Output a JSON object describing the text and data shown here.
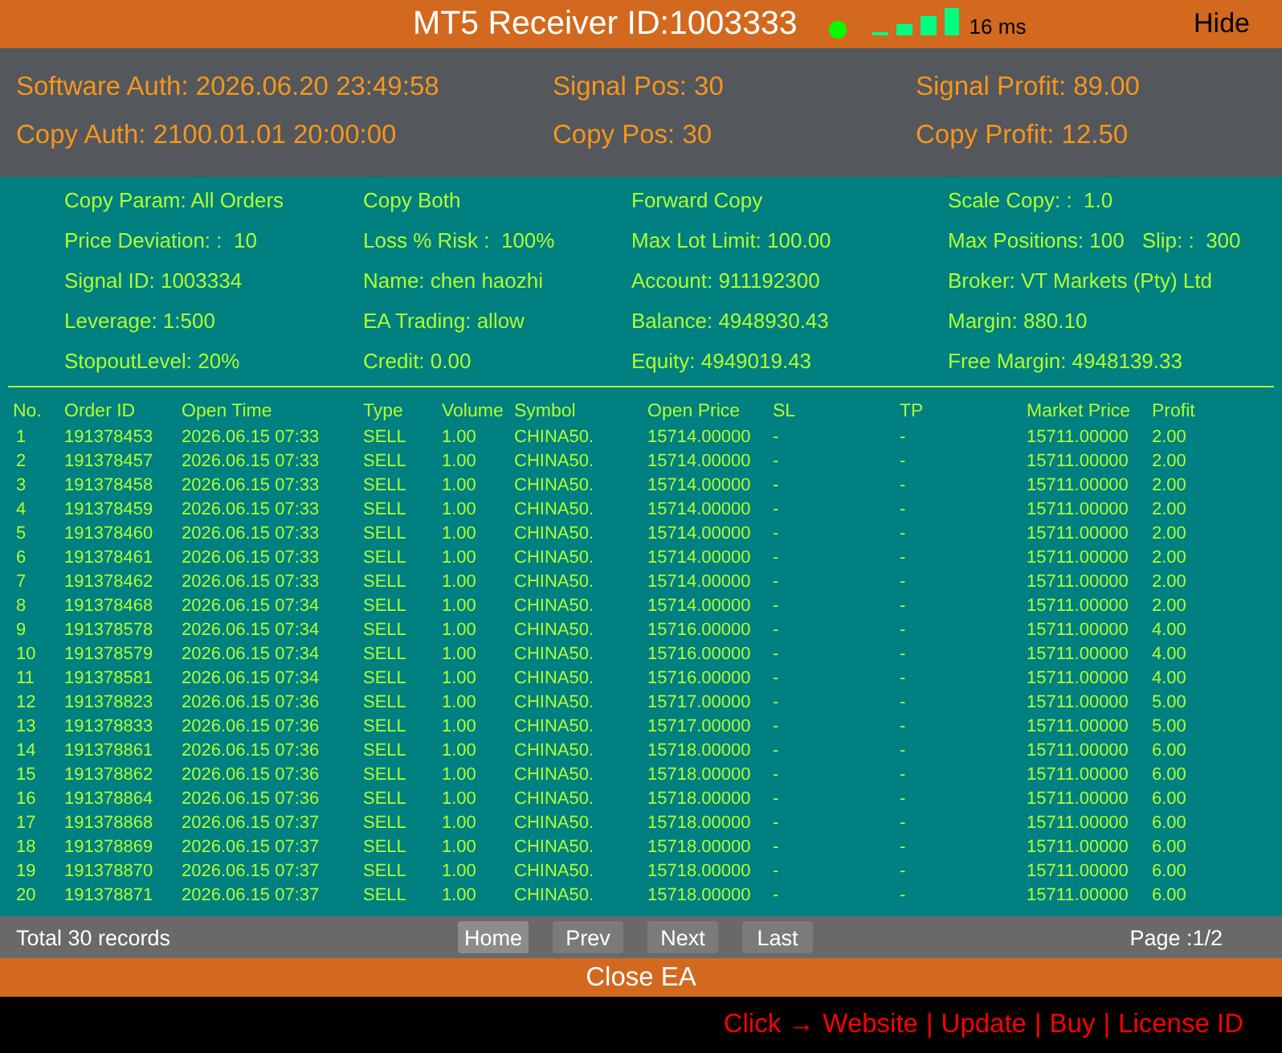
{
  "title_bar": {
    "title": "MT5 Receiver ID:1003333",
    "connected": true,
    "latency": "16 ms",
    "hide_button": "Hide"
  },
  "summary": [
    "Software Auth: 2026.06.20 23:49:58",
    "Signal Pos: 30",
    "Signal Profit: 89.00",
    "Copy Auth: 2100.01.01 20:00:00",
    "Copy Pos: 30",
    "Copy Profit: 12.50"
  ],
  "info": [
    [
      "Copy Param: All Orders"
    ],
    [
      "Copy Both"
    ],
    [
      "Forward Copy"
    ],
    [
      "Scale Copy: :  1.0"
    ],
    [
      "Price Deviation: :  10"
    ],
    [
      "Loss % Risk :  100%"
    ],
    [
      "Max Lot Limit: 100.00"
    ],
    [
      "Max Positions: 100",
      "Slip: :  300"
    ],
    [
      "Signal ID: 1003334"
    ],
    [
      "Name: chen haozhi"
    ],
    [
      "Account: 911192300"
    ],
    [
      "Broker: VT Markets (Pty) Ltd"
    ],
    [
      "Leverage: 1:500"
    ],
    [
      "EA Trading: allow"
    ],
    [
      "Balance: 4948930.43"
    ],
    [
      "Margin: 880.10"
    ],
    [
      "StopoutLevel: 20%"
    ],
    [
      "Credit: 0.00"
    ],
    [
      "Equity: 4949019.43"
    ],
    [
      "Free Margin: 4948139.33"
    ]
  ],
  "table": {
    "columns": [
      "No.",
      "Order ID",
      "Open Time",
      "Type",
      "Volume",
      "Symbol",
      "Open Price",
      "SL",
      "TP",
      "Market Price",
      "Profit"
    ],
    "rows": [
      [
        "1",
        "191378453",
        "2026.06.15 07:33",
        "SELL",
        "1.00",
        "CHINA50.",
        "15714.00000",
        "-",
        "-",
        "15711.00000",
        "2.00"
      ],
      [
        "2",
        "191378457",
        "2026.06.15 07:33",
        "SELL",
        "1.00",
        "CHINA50.",
        "15714.00000",
        "-",
        "-",
        "15711.00000",
        "2.00"
      ],
      [
        "3",
        "191378458",
        "2026.06.15 07:33",
        "SELL",
        "1.00",
        "CHINA50.",
        "15714.00000",
        "-",
        "-",
        "15711.00000",
        "2.00"
      ],
      [
        "4",
        "191378459",
        "2026.06.15 07:33",
        "SELL",
        "1.00",
        "CHINA50.",
        "15714.00000",
        "-",
        "-",
        "15711.00000",
        "2.00"
      ],
      [
        "5",
        "191378460",
        "2026.06.15 07:33",
        "SELL",
        "1.00",
        "CHINA50.",
        "15714.00000",
        "-",
        "-",
        "15711.00000",
        "2.00"
      ],
      [
        "6",
        "191378461",
        "2026.06.15 07:33",
        "SELL",
        "1.00",
        "CHINA50.",
        "15714.00000",
        "-",
        "-",
        "15711.00000",
        "2.00"
      ],
      [
        "7",
        "191378462",
        "2026.06.15 07:33",
        "SELL",
        "1.00",
        "CHINA50.",
        "15714.00000",
        "-",
        "-",
        "15711.00000",
        "2.00"
      ],
      [
        "8",
        "191378468",
        "2026.06.15 07:34",
        "SELL",
        "1.00",
        "CHINA50.",
        "15714.00000",
        "-",
        "-",
        "15711.00000",
        "2.00"
      ],
      [
        "9",
        "191378578",
        "2026.06.15 07:34",
        "SELL",
        "1.00",
        "CHINA50.",
        "15716.00000",
        "-",
        "-",
        "15711.00000",
        "4.00"
      ],
      [
        "10",
        "191378579",
        "2026.06.15 07:34",
        "SELL",
        "1.00",
        "CHINA50.",
        "15716.00000",
        "-",
        "-",
        "15711.00000",
        "4.00"
      ],
      [
        "11",
        "191378581",
        "2026.06.15 07:34",
        "SELL",
        "1.00",
        "CHINA50.",
        "15716.00000",
        "-",
        "-",
        "15711.00000",
        "4.00"
      ],
      [
        "12",
        "191378823",
        "2026.06.15 07:36",
        "SELL",
        "1.00",
        "CHINA50.",
        "15717.00000",
        "-",
        "-",
        "15711.00000",
        "5.00"
      ],
      [
        "13",
        "191378833",
        "2026.06.15 07:36",
        "SELL",
        "1.00",
        "CHINA50.",
        "15717.00000",
        "-",
        "-",
        "15711.00000",
        "5.00"
      ],
      [
        "14",
        "191378861",
        "2026.06.15 07:36",
        "SELL",
        "1.00",
        "CHINA50.",
        "15718.00000",
        "-",
        "-",
        "15711.00000",
        "6.00"
      ],
      [
        "15",
        "191378862",
        "2026.06.15 07:36",
        "SELL",
        "1.00",
        "CHINA50.",
        "15718.00000",
        "-",
        "-",
        "15711.00000",
        "6.00"
      ],
      [
        "16",
        "191378864",
        "2026.06.15 07:36",
        "SELL",
        "1.00",
        "CHINA50.",
        "15718.00000",
        "-",
        "-",
        "15711.00000",
        "6.00"
      ],
      [
        "17",
        "191378868",
        "2026.06.15 07:37",
        "SELL",
        "1.00",
        "CHINA50.",
        "15718.00000",
        "-",
        "-",
        "15711.00000",
        "6.00"
      ],
      [
        "18",
        "191378869",
        "2026.06.15 07:37",
        "SELL",
        "1.00",
        "CHINA50.",
        "15718.00000",
        "-",
        "-",
        "15711.00000",
        "6.00"
      ],
      [
        "19",
        "191378870",
        "2026.06.15 07:37",
        "SELL",
        "1.00",
        "CHINA50.",
        "15718.00000",
        "-",
        "-",
        "15711.00000",
        "6.00"
      ],
      [
        "20",
        "191378871",
        "2026.06.15 07:37",
        "SELL",
        "1.00",
        "CHINA50.",
        "15718.00000",
        "-",
        "-",
        "15711.00000",
        "6.00"
      ]
    ]
  },
  "pager": {
    "total": "Total 30 records",
    "buttons": [
      {
        "label": "Home",
        "selected": true
      },
      {
        "label": "Prev",
        "selected": false
      },
      {
        "label": "Next",
        "selected": false
      },
      {
        "label": "Last",
        "selected": false
      }
    ],
    "page": "Page :1/2"
  },
  "close_button": "Close EA",
  "link_bar": {
    "prompt": "Click →",
    "links": [
      "Website",
      "Update",
      "Buy",
      "License ID"
    ],
    "separators": [
      "|",
      "|",
      "|"
    ]
  }
}
